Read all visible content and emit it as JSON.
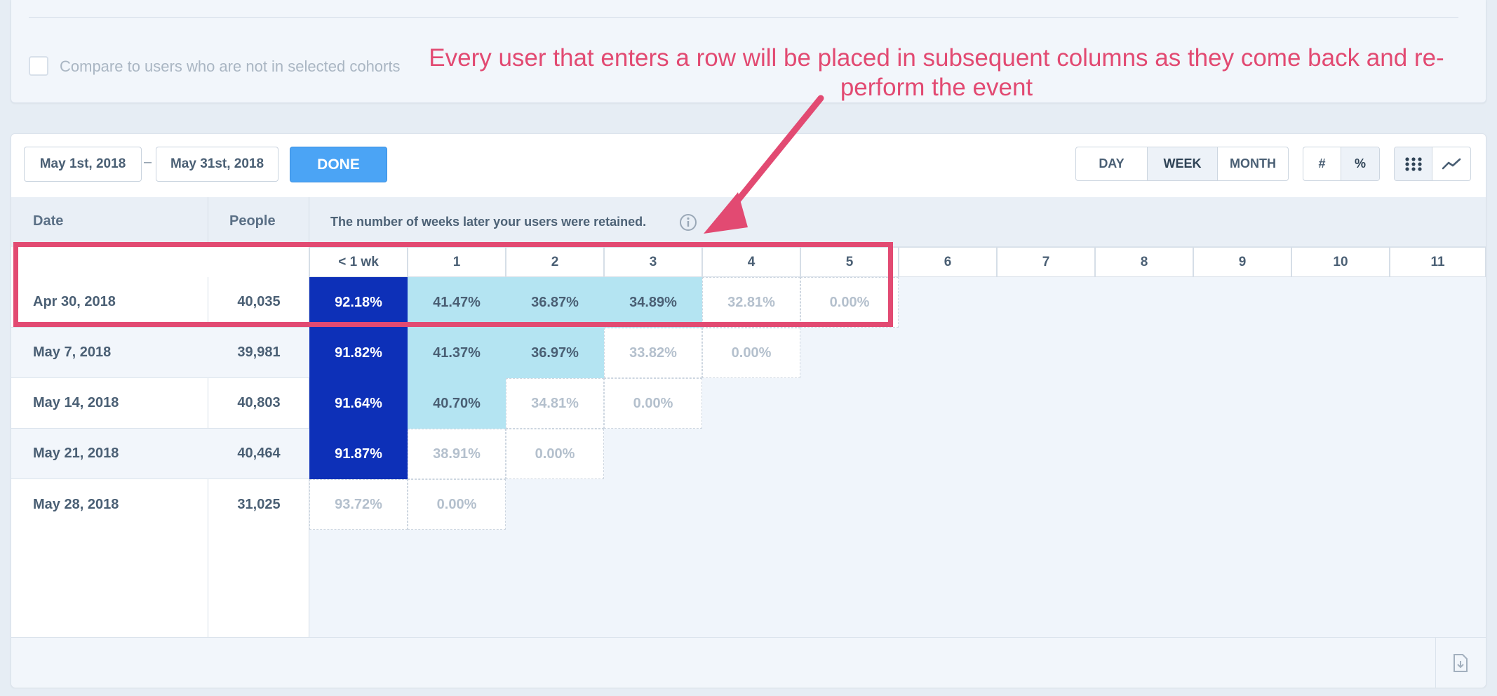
{
  "top_panel": {
    "compare_label": "Compare to users who are not in selected cohorts"
  },
  "toolbar": {
    "date_from": "May 1st, 2018",
    "date_separator": "–",
    "date_to": "May 31st, 2018",
    "done_label": "DONE",
    "interval": {
      "day": "DAY",
      "week": "WEEK",
      "month": "MONTH",
      "selected": "WEEK"
    },
    "metric": {
      "count": "#",
      "percent": "%",
      "selected": "%"
    },
    "view": {
      "grid_icon": "grid-icon",
      "line_icon": "line-chart-icon",
      "selected": "grid"
    }
  },
  "table": {
    "header_date": "Date",
    "header_people": "People",
    "header_note": "The number of weeks later your users were retained.",
    "columns": [
      "< 1 wk",
      "1",
      "2",
      "3",
      "4",
      "5",
      "6",
      "7",
      "8",
      "9",
      "10",
      "11"
    ],
    "rows": [
      {
        "date": "Apr 30, 2018",
        "people": "40,035",
        "values": [
          "92.18%",
          "41.47%",
          "36.87%",
          "34.89%",
          "32.81%",
          "0.00%"
        ],
        "styles": [
          "dark",
          "light",
          "light",
          "light",
          "faint",
          "faint"
        ]
      },
      {
        "date": "May 7, 2018",
        "people": "39,981",
        "values": [
          "91.82%",
          "41.37%",
          "36.97%",
          "33.82%",
          "0.00%"
        ],
        "styles": [
          "dark",
          "light",
          "light",
          "faint",
          "faint"
        ]
      },
      {
        "date": "May 14, 2018",
        "people": "40,803",
        "values": [
          "91.64%",
          "40.70%",
          "34.81%",
          "0.00%"
        ],
        "styles": [
          "dark",
          "light",
          "faint",
          "faint"
        ]
      },
      {
        "date": "May 21, 2018",
        "people": "40,464",
        "values": [
          "91.87%",
          "38.91%",
          "0.00%"
        ],
        "styles": [
          "dark",
          "faint",
          "faint"
        ]
      },
      {
        "date": "May 28, 2018",
        "people": "31,025",
        "values": [
          "93.72%",
          "0.00%"
        ],
        "styles": [
          "faint",
          "faint"
        ]
      }
    ]
  },
  "annotation": {
    "text": "Every user that enters a row will be placed in subsequent columns as they come back and re-perform the event",
    "color": "#e24a72"
  },
  "colors": {
    "dark_cell": "#0d30b8",
    "light_cell": "#b4e4f2",
    "done_button": "#4ba4f5"
  }
}
